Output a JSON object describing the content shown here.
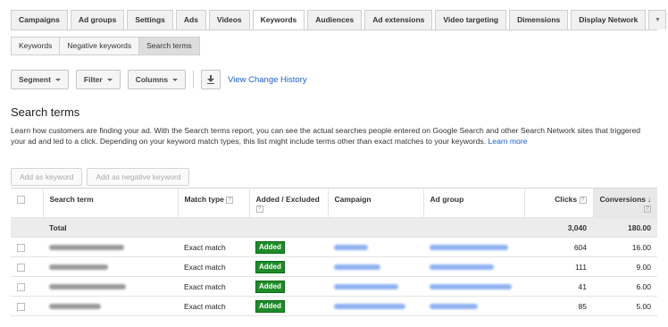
{
  "tabs": [
    "Campaigns",
    "Ad groups",
    "Settings",
    "Ads",
    "Videos",
    "Keywords",
    "Audiences",
    "Ad extensions",
    "Video targeting",
    "Dimensions",
    "Display Network"
  ],
  "active_tab": "Keywords",
  "subtabs": [
    "Keywords",
    "Negative keywords",
    "Search terms"
  ],
  "toolbar": {
    "segment": "Segment",
    "filter": "Filter",
    "columns": "Columns",
    "history": "View Change History"
  },
  "page": {
    "title": "Search terms",
    "description": "Learn how customers are finding your ad. With the Search terms report, you can see the actual searches people entered on Google Search and other Search Network sites that triggered your ad and led to a click. Depending on your keyword match types, this list might include terms other than exact matches to your keywords.",
    "learn_more": "Learn more"
  },
  "actions": {
    "add_keyword": "Add as keyword",
    "add_negative": "Add as negative keyword"
  },
  "table": {
    "headers": {
      "search_term": "Search term",
      "match_type": "Match type",
      "added_excluded": "Added / Excluded",
      "campaign": "Campaign",
      "ad_group": "Ad group",
      "clicks": "Clicks",
      "conversions": "Conversions"
    },
    "total": {
      "label": "Total",
      "clicks": "3,040",
      "conversions": "180.00"
    },
    "rows": [
      {
        "match_type": "Exact match",
        "status": "Added",
        "clicks": "604",
        "conversions": "16.00"
      },
      {
        "match_type": "Exact match",
        "status": "Added",
        "clicks": "111",
        "conversions": "9.00"
      },
      {
        "match_type": "Exact match",
        "status": "Added",
        "clicks": "41",
        "conversions": "6.00"
      },
      {
        "match_type": "Exact match",
        "status": "Added",
        "clicks": "85",
        "conversions": "5.00"
      }
    ]
  },
  "colors": {
    "link": "#1a5fc7",
    "added_badge": "#1f8b2a"
  }
}
